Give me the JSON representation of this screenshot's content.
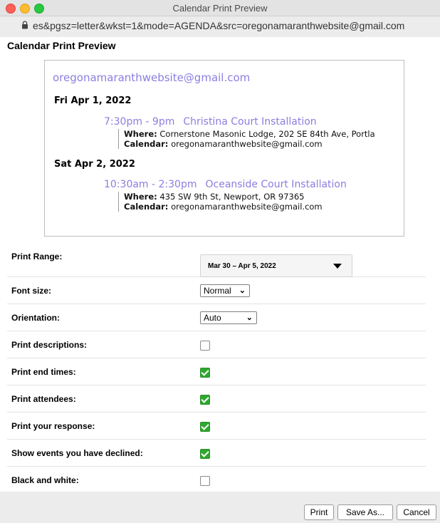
{
  "window": {
    "title": "Calendar Print Preview"
  },
  "urlbar": {
    "url": "es&pgsz=letter&wkst=1&mode=AGENDA&src=oregonamaranthwebsite@gmail.com"
  },
  "page": {
    "heading": "Calendar Print Preview"
  },
  "preview": {
    "calendar_title": "oregonamaranthwebsite@gmail.com",
    "days": [
      {
        "date": "Fri Apr 1, 2022",
        "event": {
          "time": "7:30pm - 9pm",
          "name": "Christina Court Installation",
          "where_label": "Where:",
          "where": "Cornerstone Masonic Lodge, 202 SE 84th Ave, Portla",
          "calendar_label": "Calendar:",
          "calendar": "oregonamaranthwebsite@gmail.com"
        }
      },
      {
        "date": "Sat Apr 2, 2022",
        "event": {
          "time": "10:30am - 2:30pm",
          "name": "Oceanside Court Installation",
          "where_label": "Where:",
          "where": "435 SW 9th St, Newport, OR 97365",
          "calendar_label": "Calendar:",
          "calendar": "oregonamaranthwebsite@gmail.com"
        }
      }
    ]
  },
  "options": {
    "print_range": {
      "label": "Print Range:",
      "value": "Mar 30 – Apr 5, 2022"
    },
    "font_size": {
      "label": "Font size:",
      "value": "Normal"
    },
    "orientation": {
      "label": "Orientation:",
      "value": "Auto"
    },
    "checkboxes": [
      {
        "label": "Print descriptions:",
        "checked": false
      },
      {
        "label": "Print end times:",
        "checked": true
      },
      {
        "label": "Print attendees:",
        "checked": true
      },
      {
        "label": "Print your response:",
        "checked": true
      },
      {
        "label": "Show events you have declined:",
        "checked": true
      },
      {
        "label": "Black and white:",
        "checked": false
      }
    ]
  },
  "footer": {
    "print": "Print",
    "save_as": "Save As...",
    "cancel": "Cancel"
  },
  "colors": {
    "accent": "#8a7ee0",
    "checkbox_on": "#2ea82e"
  }
}
